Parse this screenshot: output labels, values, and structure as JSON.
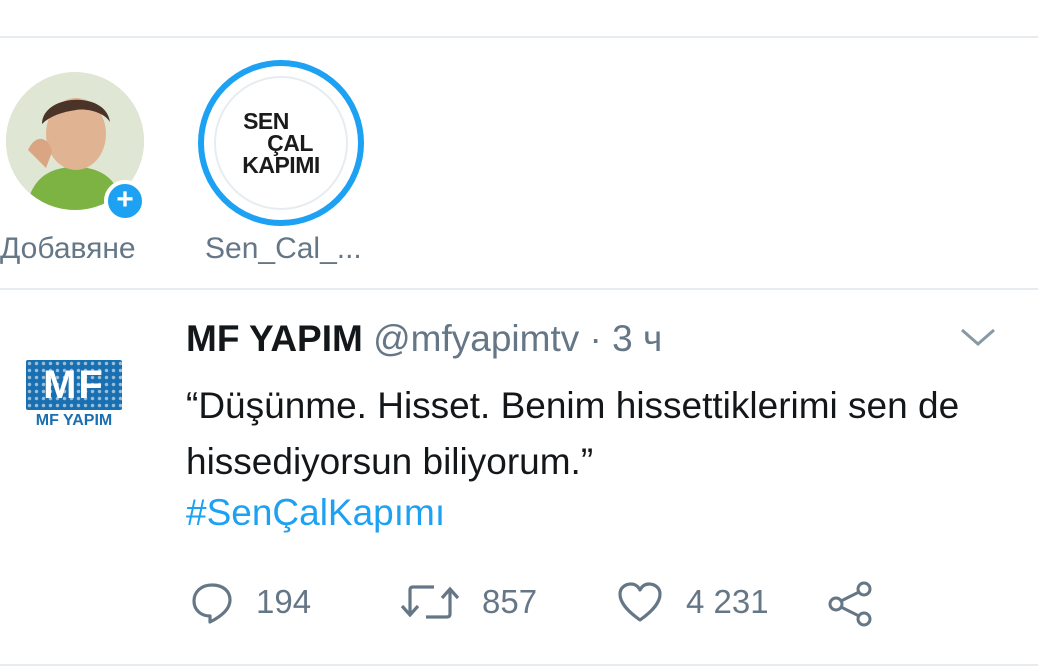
{
  "stories": [
    {
      "label": "Добавяне",
      "has_add_badge": true
    },
    {
      "label": "Sen_Cal_...",
      "logo_lines": [
        "SEN",
        "ÇAL",
        "KAPIMI"
      ]
    }
  ],
  "tweet": {
    "author_name": "MF YAPIM",
    "handle": "@mfyapimtv",
    "separator": "·",
    "time": "3 ч",
    "avatar_logo": "MF",
    "avatar_caption": "MF YAPIM",
    "text": "“Düşünme. Hisset. Benim hissettiklerimi sen de hissediyorsun biliyorum.”",
    "hashtag": "#SenÇalKapımı",
    "actions": {
      "reply_count": "194",
      "retweet_count": "857",
      "like_count": "4 231"
    }
  },
  "icons": {
    "reply": "reply-icon",
    "retweet": "retweet-icon",
    "like": "heart-icon",
    "share": "share-icon",
    "more": "chevron-down-icon",
    "add": "plus-icon"
  },
  "colors": {
    "accent": "#1da1f2",
    "text": "#14171a",
    "secondary": "#657786",
    "divider": "#e6ecf0"
  }
}
